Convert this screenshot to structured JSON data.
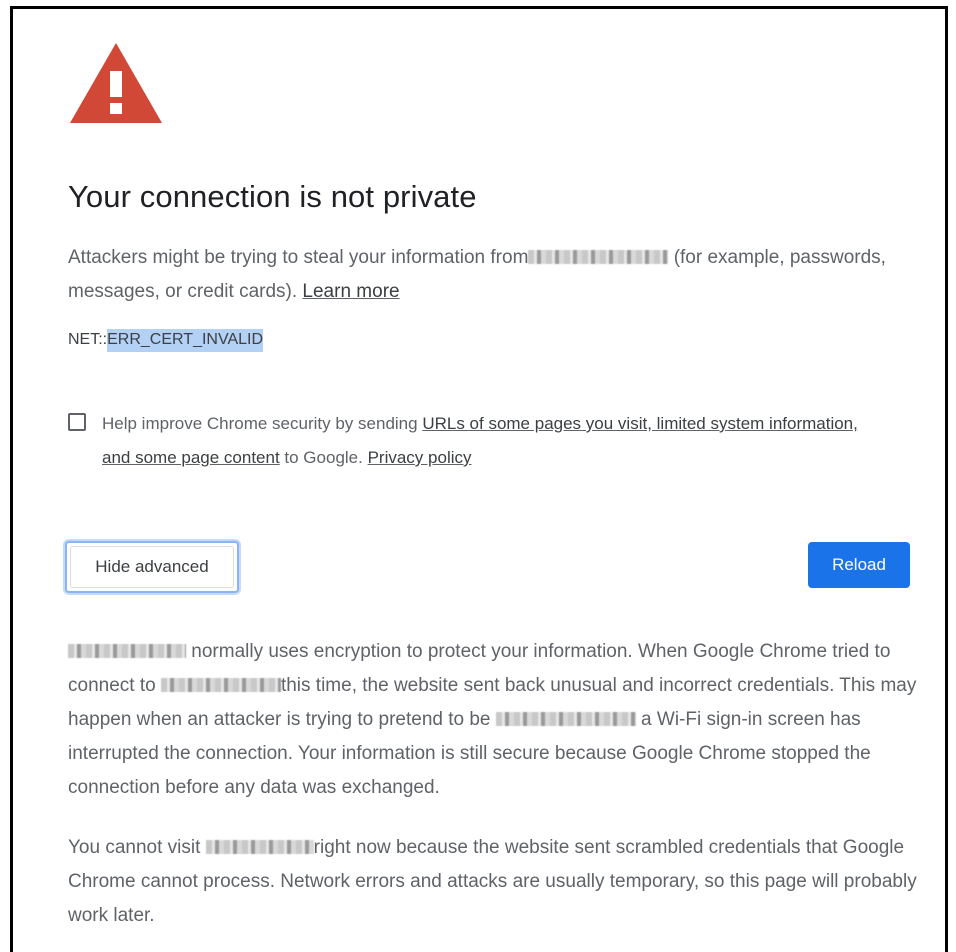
{
  "interstitial": {
    "title": "Your connection is not private",
    "intro": {
      "text_before": "Attackers might be trying to steal your information from",
      "text_after": " (for example, passwords, messages, or credit cards). ",
      "learn_more": "Learn more"
    },
    "error_prefix": "NET::",
    "error_code": "ERR_CERT_INVALID",
    "checkbox": {
      "checked": false,
      "text_before": "Help improve Chrome security by sending ",
      "link_text": "URLs of some pages you visit, limited system information, and some page content",
      "text_middle": " to Google. ",
      "privacy_link": "Privacy policy"
    },
    "buttons": {
      "hide_advanced": "Hide advanced",
      "reload": "Reload"
    },
    "details": {
      "p1_after_host": " normally uses encryption to protect your information. When Google Chrome tried to connect to ",
      "p1_after_host2": "this time, the website sent back unusual and incorrect credentials. This may happen when an attacker is trying to pretend to be ",
      "p1_after_host3": " a Wi-Fi sign-in screen has interrupted the connection. Your information is still secure because Google Chrome stopped the connection before any data was exchanged.",
      "p2_before_host": "You cannot visit ",
      "p2_after_host": "right now because the website sent scrambled credentials that Google Chrome cannot process. Network errors and attacks are usually temporary, so this page will probably work later."
    }
  },
  "colors": {
    "warning_red": "#d14836",
    "primary_blue": "#1a73e8",
    "selection": "#b3d0f5",
    "body_text": "#5f6368",
    "heading_text": "#202124"
  }
}
